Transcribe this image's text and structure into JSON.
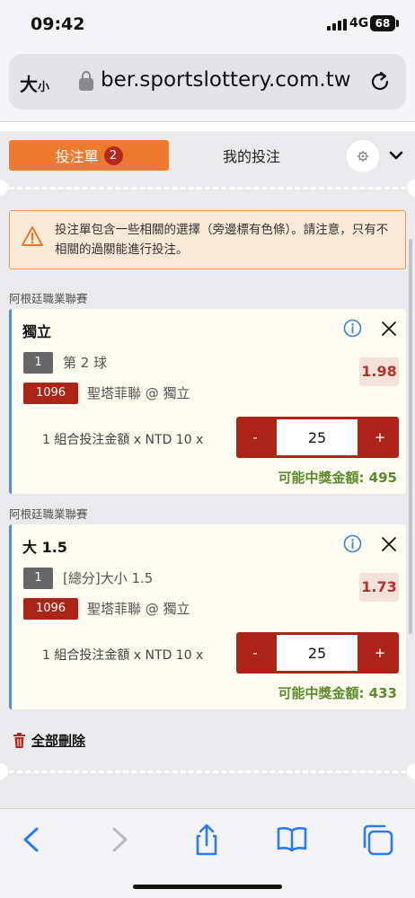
{
  "status_bar": {
    "time": "09:42",
    "network": "4G",
    "battery": "68"
  },
  "browser": {
    "text_size_label": "大",
    "text_size_label_small": "小",
    "url": "ber.sportslottery.com.tw"
  },
  "betslip": {
    "tab_betslip": "投注單",
    "tab_betslip_count": "2",
    "tab_my_bets": "我的投注",
    "warning": "投注單包含一些相關的選擇（旁邊標有色條）。請注意，只有不相關的過關能進行投注。",
    "selections": [
      {
        "league": "阿根廷職業聯賽",
        "title": "獨立",
        "number": "1",
        "market": "第 2 球",
        "odds": "1.98",
        "code": "1096",
        "match": "聖塔菲聯 @ 獨立",
        "stake_label": "1 組合投注金額 x NTD 10 x",
        "minus": "-",
        "plus": "+",
        "stake": "25",
        "payout": "可能中獎金額: 495"
      },
      {
        "league": "阿根廷職業聯賽",
        "title": "大 1.5",
        "number": "1",
        "market": "[總分]大小 1.5",
        "odds": "1.73",
        "code": "1096",
        "match": "聖塔菲聯 @ 獨立",
        "stake_label": "1 組合投注金額 x NTD 10 x",
        "minus": "-",
        "plus": "+",
        "stake": "25",
        "payout": "可能中獎金額: 433"
      }
    ],
    "delete_all": "全部刪除"
  },
  "colors": {
    "accent_orange": "#ee7a2d",
    "brand_red": "#ad2419",
    "payout_green": "#5c8a2b",
    "related_bar_blue": "#4e8fd6"
  }
}
